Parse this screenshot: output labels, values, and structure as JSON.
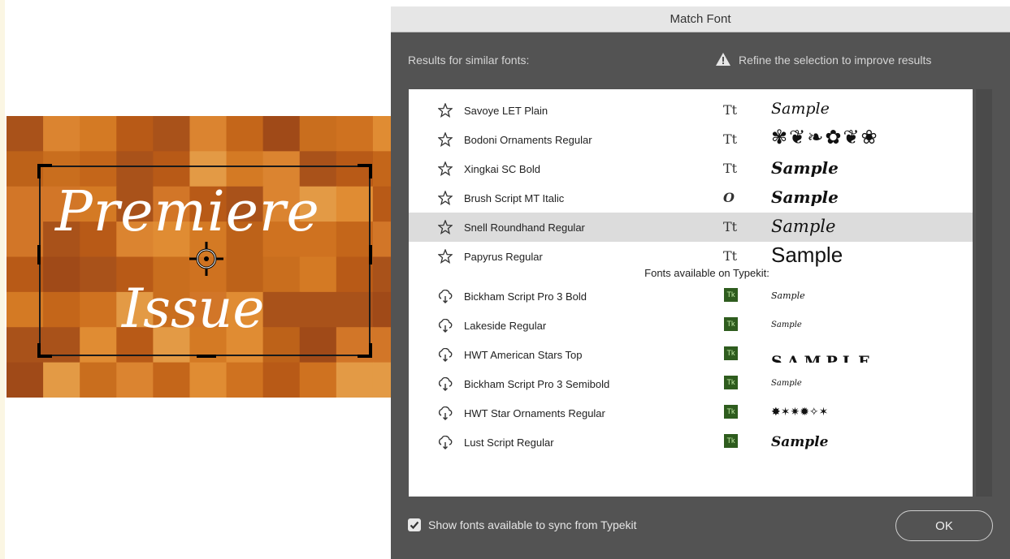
{
  "canvas": {
    "title_line1": "Premiere",
    "title_line2": "Issue"
  },
  "dialog": {
    "title": "Match Font",
    "results_label": "Results for similar fonts:",
    "warning": "Refine the selection to improve results",
    "local_fonts": [
      {
        "name": "Savoye LET Plain",
        "type_icon": "Tt",
        "sample": "Sample"
      },
      {
        "name": "Bodoni Ornaments Regular",
        "type_icon": "Tt",
        "sample": "✾❦❧✿❦❀"
      },
      {
        "name": "Xingkai SC Bold",
        "type_icon": "Tt",
        "sample": "Sample"
      },
      {
        "name": "Brush Script MT Italic",
        "type_icon": "O",
        "sample": "Sample"
      },
      {
        "name": "Snell Roundhand Regular",
        "type_icon": "Tt",
        "sample": "Sample",
        "selected": true
      },
      {
        "name": "Papyrus Regular",
        "type_icon": "Tt",
        "sample": "Sample"
      }
    ],
    "typekit_heading": "Fonts available on Typekit:",
    "typekit_fonts": [
      {
        "name": "Bickham Script Pro 3 Bold",
        "badge": "Tk",
        "sample": "Sample"
      },
      {
        "name": "Lakeside Regular",
        "badge": "Tk",
        "sample": "Sample"
      },
      {
        "name": "HWT American Stars Top",
        "badge": "Tk",
        "sample": "SAMPLE"
      },
      {
        "name": "Bickham Script Pro 3 Semibold",
        "badge": "Tk",
        "sample": "Sample"
      },
      {
        "name": "HWT Star Ornaments Regular",
        "badge": "Tk",
        "sample": "✸✶✷✹✧✶"
      },
      {
        "name": "Lust Script Regular",
        "badge": "Tk",
        "sample": "Sample"
      }
    ],
    "sync_checkbox": {
      "label": "Show fonts available to sync from Typekit",
      "checked": true
    },
    "ok_button": "OK"
  },
  "icons": {
    "star": "star-icon",
    "cloud": "cloud-sync-icon",
    "warning": "warning-icon",
    "type": "truetype-icon",
    "typekit": "typekit-badge"
  }
}
